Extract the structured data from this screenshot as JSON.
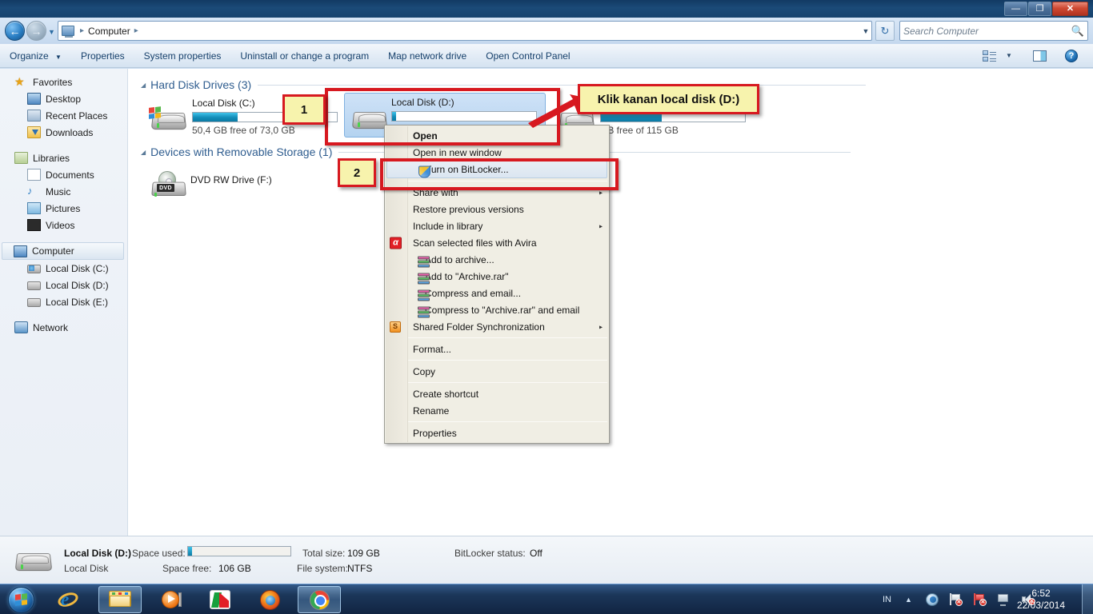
{
  "window": {
    "controls": {
      "minimize": "—",
      "maximize": "❐",
      "close": "✕"
    }
  },
  "address_bar": {
    "computer_icon": "computer-icon",
    "crumbs": [
      "Computer"
    ],
    "separator": "▸",
    "dropdown": "▼",
    "refresh": "↻",
    "history_chevron": "▼"
  },
  "search": {
    "placeholder": "Search Computer",
    "value": "",
    "icon": "search-icon"
  },
  "toolbar": {
    "items": [
      {
        "label": "Organize",
        "caret": "▼"
      },
      {
        "label": "Properties"
      },
      {
        "label": "System properties"
      },
      {
        "label": "Uninstall or change a program"
      },
      {
        "label": "Map network drive"
      },
      {
        "label": "Open Control Panel"
      }
    ],
    "view_caret": "▼",
    "help_glyph": "?"
  },
  "nav_pane": {
    "groups": [
      {
        "header": {
          "label": "Favorites",
          "icon": "star-icon"
        },
        "items": [
          {
            "label": "Desktop",
            "icon": "desktop-icon"
          },
          {
            "label": "Recent Places",
            "icon": "recent-places-icon"
          },
          {
            "label": "Downloads",
            "icon": "downloads-icon"
          }
        ]
      },
      {
        "header": {
          "label": "Libraries",
          "icon": "libraries-icon"
        },
        "items": [
          {
            "label": "Documents",
            "icon": "documents-icon"
          },
          {
            "label": "Music",
            "icon": "music-icon"
          },
          {
            "label": "Pictures",
            "icon": "pictures-icon"
          },
          {
            "label": "Videos",
            "icon": "videos-icon"
          }
        ]
      },
      {
        "header": {
          "label": "Computer",
          "icon": "computer-icon",
          "selected": true
        },
        "items": [
          {
            "label": "Local Disk (C:)",
            "icon": "system-drive-icon"
          },
          {
            "label": "Local Disk (D:)",
            "icon": "drive-icon"
          },
          {
            "label": "Local Disk (E:)",
            "icon": "drive-icon"
          }
        ]
      },
      {
        "header": {
          "label": "Network",
          "icon": "network-icon"
        },
        "items": []
      }
    ]
  },
  "file_list": {
    "groups": [
      {
        "label": "Hard Disk Drives (3)",
        "tri": "◢"
      },
      {
        "label": "Devices with Removable Storage (1)",
        "tri": "◢"
      }
    ],
    "drives": [
      {
        "name": "Local Disk (C:)",
        "free_text": "50,4 GB free of 73,0 GB",
        "used_percent": 31,
        "icon": "system-drive-icon",
        "selected": false
      },
      {
        "name": "Local Disk (D:)",
        "free_text": "",
        "used_percent": 3,
        "icon": "drive-icon",
        "selected": true
      },
      {
        "name": "",
        "free_text": "GB free of 115 GB",
        "used_percent": 42,
        "icon": "drive-icon",
        "selected": false
      }
    ],
    "removable": [
      {
        "name": "DVD RW Drive (F:)",
        "icon": "dvd-drive-icon",
        "tag": "DVD"
      }
    ]
  },
  "context_menu": {
    "items": [
      {
        "label": "Open",
        "bold": true
      },
      {
        "label": "Open in new window"
      },
      {
        "label": "Turn on BitLocker...",
        "icon": "shield-icon",
        "highlighted": true
      },
      {
        "separator": true
      },
      {
        "label": "Share with",
        "submenu": "▸"
      },
      {
        "label": "Restore previous versions"
      },
      {
        "label": "Include in library",
        "submenu": "▸"
      },
      {
        "label": "Scan selected files with Avira",
        "icon": "avira-icon"
      },
      {
        "label": "Add to archive...",
        "icon": "winrar-icon"
      },
      {
        "label": "Add to \"Archive.rar\"",
        "icon": "winrar-icon"
      },
      {
        "label": "Compress and email...",
        "icon": "winrar-icon"
      },
      {
        "label": "Compress to \"Archive.rar\" and email",
        "icon": "winrar-icon"
      },
      {
        "label": "Shared Folder Synchronization",
        "icon": "shared-folder-sync-icon",
        "submenu": "▸"
      },
      {
        "separator": true
      },
      {
        "label": "Format..."
      },
      {
        "separator": true
      },
      {
        "label": "Copy"
      },
      {
        "separator": true
      },
      {
        "label": "Create shortcut"
      },
      {
        "label": "Rename"
      },
      {
        "separator": true
      },
      {
        "label": "Properties"
      }
    ]
  },
  "annotations": {
    "step1": "1",
    "step2": "2",
    "tooltip": "Klik kanan local disk (D:)",
    "color": "#d71920",
    "callout_bg": "#f7f3ad"
  },
  "details_pane": {
    "title": "Local Disk (D:)",
    "subtitle": "Local Disk",
    "space_used_label": "Space used:",
    "space_free_label": "Space free:",
    "space_free_value": "106 GB",
    "total_size_label": "Total size:",
    "total_size_value": "109 GB",
    "file_system_label": "File system:",
    "file_system_value": "NTFS",
    "bitlocker_label": "BitLocker status:",
    "bitlocker_value": "Off",
    "used_percent": 4
  },
  "taskbar": {
    "start": "start-orb",
    "apps": [
      {
        "name": "internet-explorer",
        "active": false
      },
      {
        "name": "windows-explorer",
        "active": true
      },
      {
        "name": "windows-media-player",
        "active": false
      },
      {
        "name": "avira",
        "active": false
      },
      {
        "name": "firefox",
        "active": false
      },
      {
        "name": "google-chrome",
        "active": true
      }
    ],
    "tray": {
      "language": "IN",
      "show_hidden": "▲",
      "icons": [
        "action-center-icon",
        "network-flag-icon",
        "antivirus-icon",
        "network-icon",
        "volume-icon"
      ],
      "time": "6:52",
      "date": "22/03/2014"
    }
  }
}
